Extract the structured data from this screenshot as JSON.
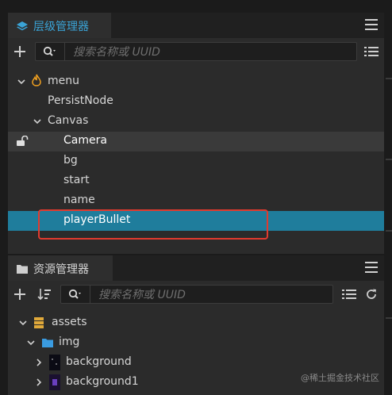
{
  "hierarchy": {
    "tab_label": "层级管理器",
    "search_placeholder": "搜索名称或 UUID",
    "nodes": [
      {
        "label": "menu"
      },
      {
        "label": "PersistNode"
      },
      {
        "label": "Canvas"
      },
      {
        "label": "Camera"
      },
      {
        "label": "bg"
      },
      {
        "label": "start"
      },
      {
        "label": "name"
      },
      {
        "label": "playerBullet"
      }
    ]
  },
  "assets": {
    "tab_label": "资源管理器",
    "search_placeholder": "搜索名称或 UUID",
    "items": [
      {
        "label": "assets"
      },
      {
        "label": "img"
      },
      {
        "label": "background"
      },
      {
        "label": "background1"
      }
    ]
  },
  "watermark": "@稀土掘金技术社区",
  "colors": {
    "accent": "#3aa3d6",
    "selection": "#1f7d9c",
    "highlight_box": "#e23a2e"
  }
}
